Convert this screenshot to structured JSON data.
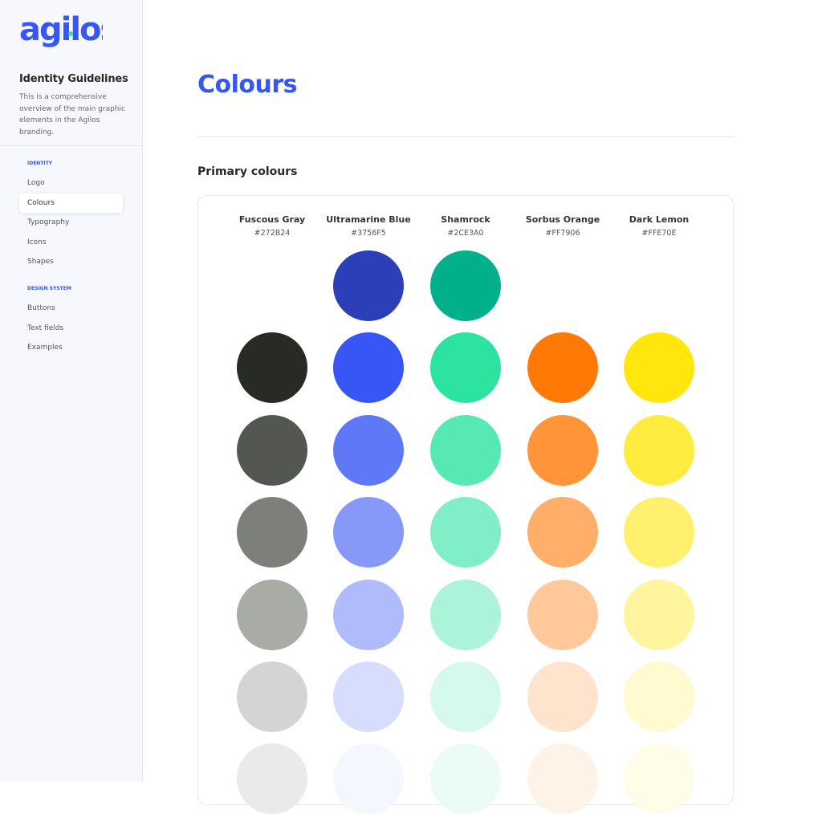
{
  "sidebar": {
    "logo_text": "agilos",
    "title": "Identity Guidelines",
    "description": "This is a comprehensive overview of the main graphic elements in the Agilos branding.",
    "sections": [
      {
        "label": "IDENTITY",
        "items": [
          "Logo",
          "Colours",
          "Typography",
          "Icons",
          "Shapes"
        ]
      },
      {
        "label": "DESIGN SYSTEM",
        "items": [
          "Buttons",
          "Text fields",
          "Examples"
        ]
      }
    ],
    "active_item": "Colours"
  },
  "main": {
    "title": "Colours",
    "section_title": "Primary colours",
    "colours": [
      {
        "name": "Fuscous Gray",
        "hex": "#272B24",
        "shades": [
          null,
          "#272B24",
          "#545651",
          "#7D7F7B",
          "#A9ABA7",
          "#D3D4D3",
          "#E9EAE9"
        ]
      },
      {
        "name": "Ultramarine Blue",
        "hex": "#3756F5",
        "shades": [
          "#2A3FB8",
          "#3756F5",
          "#5F78F7",
          "#8799F8",
          "#AFBBFA",
          "#D7DDFD",
          "#F5F7FE"
        ]
      },
      {
        "name": "Shamrock",
        "hex": "#2CE3A0",
        "shades": [
          "#00B08A",
          "#2CE3A0",
          "#56E9B3",
          "#80EEC6",
          "#ABF4D9",
          "#D5F9EC",
          "#EAFCF5"
        ]
      },
      {
        "name": "Sorbus Orange",
        "hex": "#FF7906",
        "shades": [
          null,
          "#FF7906",
          "#FF9438",
          "#FFAF6A",
          "#FFC99B",
          "#FFE4CD",
          "#FFF2E6"
        ]
      },
      {
        "name": "Dark Lemon",
        "hex": "#FFE70E",
        "shades": [
          null,
          "#FFE70E",
          "#FFEC3E",
          "#FFF06E",
          "#FFF59F",
          "#FFFACF",
          "#FFFDE7"
        ]
      }
    ]
  }
}
